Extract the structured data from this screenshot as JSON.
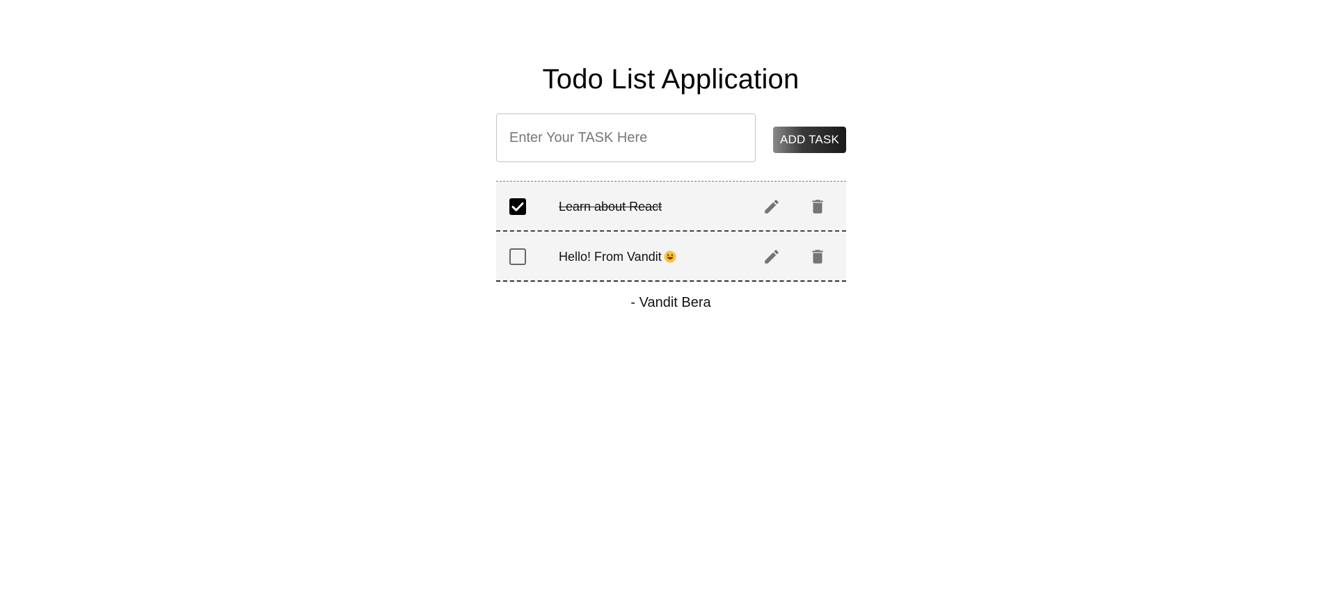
{
  "app": {
    "title": "Todo List Application"
  },
  "form": {
    "input_placeholder": "Enter Your TASK Here",
    "input_value": "",
    "add_button_label": "ADD TASK"
  },
  "todos": [
    {
      "text": "Learn about React",
      "completed": true,
      "emoji": ""
    },
    {
      "text": "Hello! From Vandit",
      "completed": false,
      "emoji": "grinning-face-emoji"
    }
  ],
  "icons": {
    "checkbox_checked": "checkbox-checked-icon",
    "checkbox_unchecked": "checkbox-unchecked-icon",
    "edit": "pencil-icon",
    "delete": "trash-icon"
  },
  "colors": {
    "icon_gray": "#757575",
    "row_background": "#f4f4f4",
    "button_dark": "#1a1a1a"
  },
  "footer": {
    "signature": "- Vandit Bera"
  }
}
